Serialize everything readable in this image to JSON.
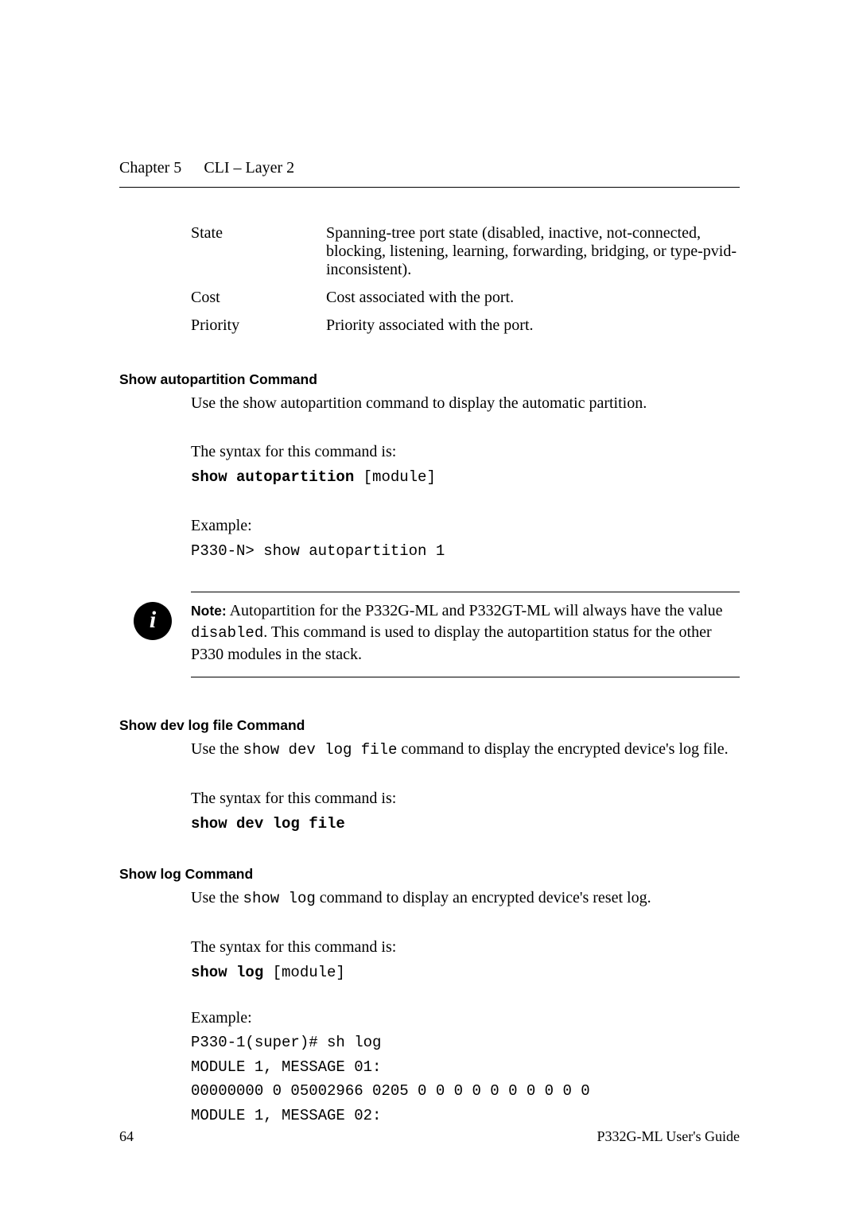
{
  "header": {
    "chapter": "Chapter 5",
    "section": "CLI – Layer 2"
  },
  "definitions": [
    {
      "term": "State",
      "desc": "Spanning-tree port state (disabled, inactive, not-connected, blocking, listening, learning, forwarding, bridging, or type-pvid-inconsistent)."
    },
    {
      "term": "Cost",
      "desc": "Cost associated with the port."
    },
    {
      "term": "Priority",
      "desc": "Priority associated with the port."
    }
  ],
  "sections": {
    "autopartition": {
      "heading": "Show autopartition Command",
      "intro": "Use the show autopartition command to display the automatic partition.",
      "syntax_label": "The syntax for this command is:",
      "syntax_bold": "show autopartition",
      "syntax_arg": " [module]",
      "example_label": "Example:",
      "example_line": "P330-N> show autopartition 1",
      "note_label": "Note:",
      "note_text_1": "  Autopartition for the P332G-ML and P332GT-ML will always have the value ",
      "note_code": "disabled",
      "note_text_2": ". This command is used to display the autopartition status for the other P330 modules in the stack."
    },
    "devlog": {
      "heading": "Show dev log file Command",
      "intro_prefix": "Use the ",
      "intro_code": "show dev log file",
      "intro_suffix": " command to display the encrypted device's log file.",
      "syntax_label": "The syntax for this command is:",
      "syntax_bold": "show dev log file"
    },
    "showlog": {
      "heading": "Show log Command",
      "intro_prefix": "Use the ",
      "intro_code": "show log",
      "intro_suffix": " command to display an encrypted device's reset log.",
      "syntax_label": "The syntax for this command is:",
      "syntax_bold": "show log",
      "syntax_arg": " [module]",
      "example_label": "Example:",
      "example_lines": [
        "P330-1(super)# sh log",
        "MODULE 1, MESSAGE 01:",
        "00000000 0 05002966 0205 0 0 0 0 0 0 0 0 0 0",
        "MODULE 1, MESSAGE 02:"
      ]
    }
  },
  "footer": {
    "page": "64",
    "doc": "P332G-ML User's Guide"
  }
}
